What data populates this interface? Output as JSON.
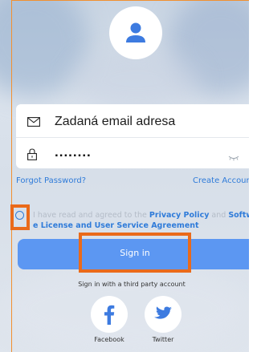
{
  "login": {
    "email_value": "Zadaná email adresa",
    "password_value": "........",
    "forgot_password": "Forgot Password?",
    "create_account": "Create Accoun",
    "agreement": {
      "prefix": "I have read and agreed to the ",
      "privacy_policy": "Privacy Policy",
      "and": " and ",
      "software_part1": "Softwar",
      "software_part2": "e License and User Service Agreement"
    },
    "sign_in": "Sign in",
    "third_party_heading": "Sign in with a third party account",
    "providers": [
      {
        "label": "Facebook",
        "icon": "facebook-icon"
      },
      {
        "label": "Twitter",
        "icon": "twitter-icon"
      }
    ]
  },
  "colors": {
    "accent": "#2f7bd9",
    "button": "#5c97f2",
    "highlight": "#ea6a1a"
  }
}
